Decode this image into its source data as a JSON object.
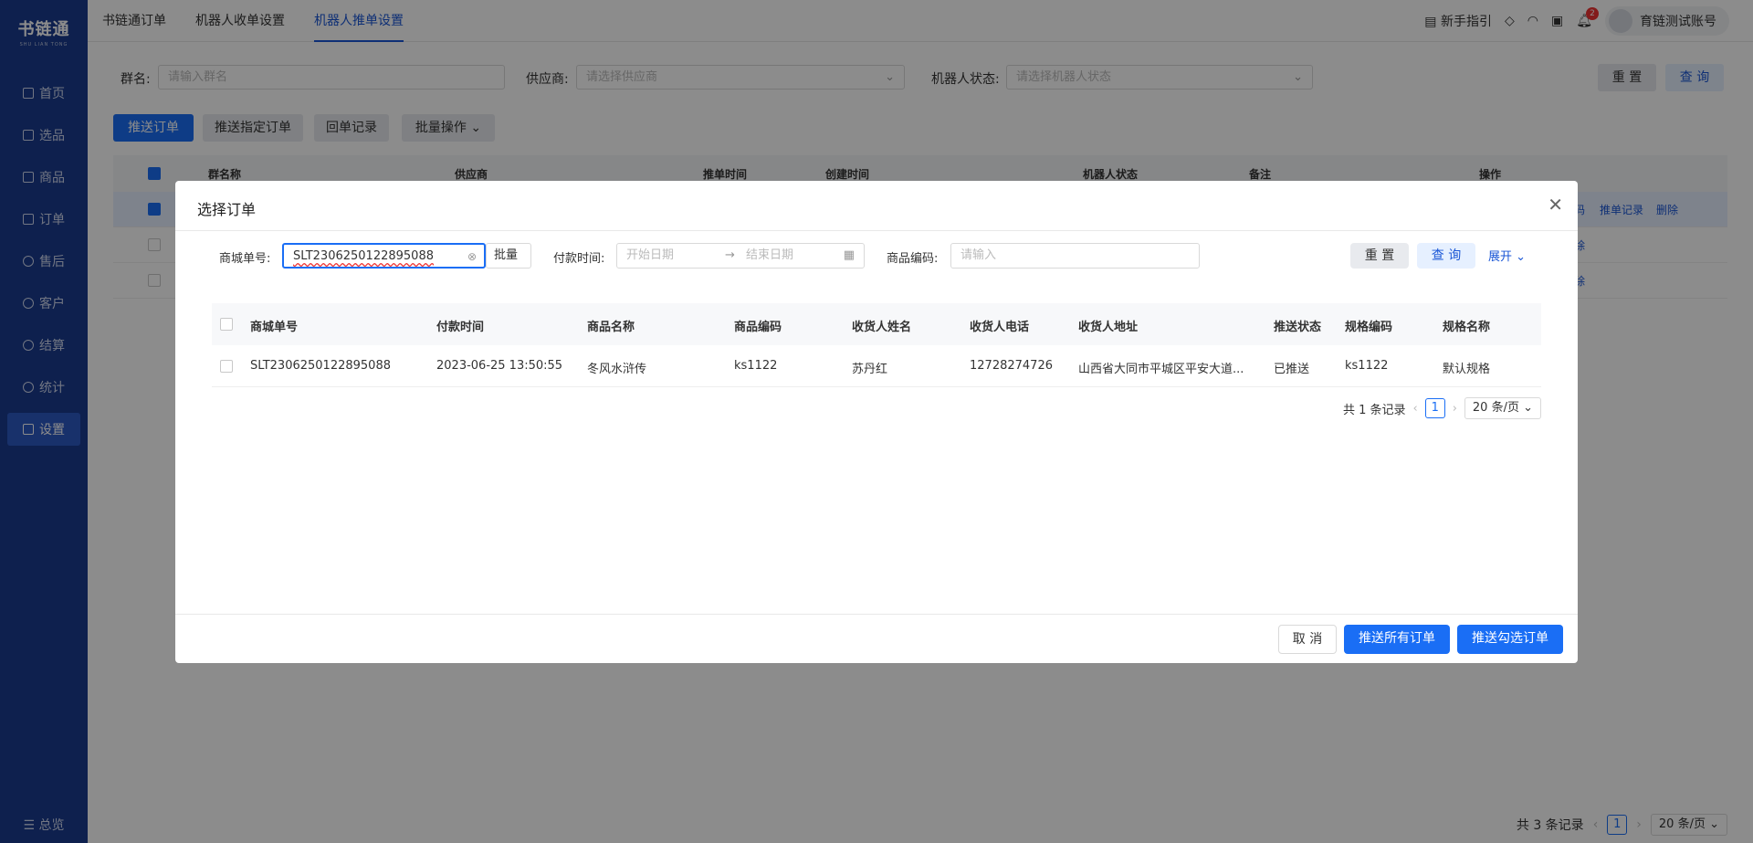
{
  "sidebar": {
    "logo_cn": "书链通",
    "logo_en": "SHU LIAN TONG",
    "items": [
      {
        "label": "首页"
      },
      {
        "label": "选品"
      },
      {
        "label": "商品"
      },
      {
        "label": "订单"
      },
      {
        "label": "售后"
      },
      {
        "label": "客户"
      },
      {
        "label": "结算"
      },
      {
        "label": "统计"
      },
      {
        "label": "设置"
      }
    ],
    "collapse_label": "总览"
  },
  "topbar": {
    "tabs": [
      {
        "label": "书链通订单"
      },
      {
        "label": "机器人收单设置"
      },
      {
        "label": "机器人推单设置"
      }
    ],
    "guide_label": "新手指引",
    "notification_count": "2",
    "account_name": "育链测试账号"
  },
  "filters": {
    "group_label": "群名:",
    "group_placeholder": "请输入群名",
    "supplier_label": "供应商:",
    "supplier_placeholder": "请选择供应商",
    "status_label": "机器人状态:",
    "status_placeholder": "请选择机器人状态",
    "reset_label": "重 置",
    "query_label": "查 询"
  },
  "actions": {
    "push_order": "推送订单",
    "push_specified": "推送指定订单",
    "callback_records": "回单记录",
    "batch_ops": "批量操作"
  },
  "main_table": {
    "headers": [
      "群名称",
      "供应商",
      "推单时间",
      "创建时间",
      "机器人状态",
      "备注",
      "操作"
    ],
    "row1_ops": [
      "码",
      "推单记录",
      "删除"
    ],
    "row2_op": "除",
    "row3_op": "除"
  },
  "main_pagination": {
    "total": "共 3 条记录",
    "page": "1",
    "page_size": "20 条/页"
  },
  "modal": {
    "title": "选择订单",
    "order_no_label": "商城单号:",
    "order_no_value": "SLT2306250122895088",
    "batch_label": "批量",
    "pay_time_label": "付款时间:",
    "start_date_placeholder": "开始日期",
    "end_date_placeholder": "结束日期",
    "product_code_label": "商品编码:",
    "product_code_placeholder": "请输入",
    "reset_label": "重 置",
    "query_label": "查 询",
    "expand_label": "展开",
    "table": {
      "headers": [
        "商城单号",
        "付款时间",
        "商品名称",
        "商品编码",
        "收货人姓名",
        "收货人电话",
        "收货人地址",
        "推送状态",
        "规格编码",
        "规格名称"
      ],
      "rows": [
        [
          "SLT2306250122895088",
          "2023-06-25 13:50:55",
          "冬风水浒传",
          "ks1122",
          "苏丹红",
          "12728274726",
          "山西省大同市平城区平安大道...",
          "已推送",
          "ks1122",
          "默认规格"
        ]
      ]
    },
    "pagination": {
      "total": "共 1 条记录",
      "page": "1",
      "page_size": "20 条/页"
    },
    "cancel_label": "取 消",
    "push_all_label": "推送所有订单",
    "push_checked_label": "推送勾选订单"
  },
  "colors": {
    "sidebar_bg": "#1a3b8e",
    "primary": "#1a6ef5",
    "accent_text": "#1a56d6"
  }
}
